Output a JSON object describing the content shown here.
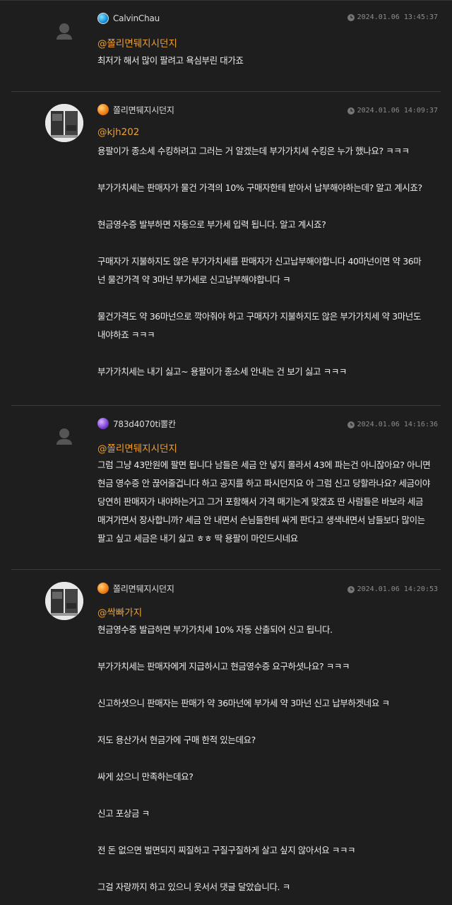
{
  "colors": {
    "background": "#1e1e1e",
    "mention": "#f0a030",
    "text": "#ececec",
    "date": "#8c8c8c"
  },
  "comments": [
    {
      "author": "CalvinChau",
      "author_icon": "globe-badge-icon",
      "date": "2024.01.06 13:45:37",
      "mention": "@쫄리면뒈지시던지",
      "lines": [
        "최저가 해서 많이 팔려고 욕심부린 대가죠"
      ]
    },
    {
      "author": "쫄리면뒈지시던지",
      "author_icon": "orange-ball-icon",
      "date": "2024.01.06 14:09:37",
      "mention": "@kjh202",
      "lines": [
        "용팔이가 종소세 수킹하려고 그러는 거 알겠는데 부가가치세 수킹은 누가 했나요?  ㅋㅋㅋ",
        "",
        "부가가치세는 판매자가 물건 가격의 10% 구매자한테 받아서 납부해야하는데?  알고 계시죠?",
        "",
        "현금영수증 발부하면 자동으로 부가세 입력 됩니다. 알고 계시죠?",
        "",
        "구매자가 지불하지도 않은 부가가치세를 판매자가 신고납부해야합니다 40마넌이면 약 36마",
        "넌 물건가격 약 3마넌 부가세로 신고납부해야합니다 ㅋ",
        "",
        "물건가격도 약 36마넌으로 깍아줘야 하고 구매자가 지불하지도 않은 부가가치세 약 3마넌도",
        "내야하죠 ㅋㅋㅋ",
        "",
        "부가가치세는 내기 싫고~  용팔이가 종소세 안내는 건 보기 싫고 ㅋㅋㅋ"
      ]
    },
    {
      "author": "783d4070ti뽈칸",
      "author_icon": "purple-ball-icon",
      "date": "2024.01.06 14:16:36",
      "mention": "@쫄리면뒈지시던지",
      "lines": [
        "그럼 그냥 43만원에 팔면 됩니다 남들은 세금 안 넣지 몰라서 43에 파는건 아니잖아요?  아니면",
        "현금 영수증 안 끊어줄겁니다 하고 공지를 하고 파시던지요 아 그럼 신고 당할라나요? 세금이야",
        "당연히 판매자가 내야하는거고 그거 포함해서 가격 매기는게 맞겠죠 딴 사람들은 바보라 세금",
        "매겨가면서 장사합니까?  세금 안 내면서 손님들한테 싸게 판다고 생색내면서 남들보다 많이는",
        "팔고 싶고 세금은 내기 싫고 ㅎㅎ 딱 용팔이 마인드시네요"
      ]
    },
    {
      "author": "쫄리면뒈지시던지",
      "author_icon": "orange-ball-icon",
      "date": "2024.01.06 14:20:53",
      "mention": "@싹빠가지",
      "lines": [
        "현금영수증 발급하면 부가가치세 10% 자동 산출되어 신고 됩니다.",
        "",
        "부가가치세는 판매자에게 지급하시고 현금영수증 요구하셧나요?  ㅋㅋㅋ",
        "",
        "신고하셧으니 판매자는 판매가 약 36마넌에 부가세 약 3마넌 신고 납부하겟네요 ㅋ",
        "",
        "저도 용산가서 현금가에 구매 한적 있는데요?",
        "",
        "싸게 샀으니 만족하는데요?",
        "",
        "신고 포상금 ㅋ",
        "",
        "전 돈 없으면 벌면되지 찌질하고 구질구질하게 살고 싶지 않아서요 ㅋㅋㅋ",
        "",
        "그걸 자랑까지 하고 있으니 웃서서 댓글 달았습니다. ㅋ"
      ]
    }
  ]
}
